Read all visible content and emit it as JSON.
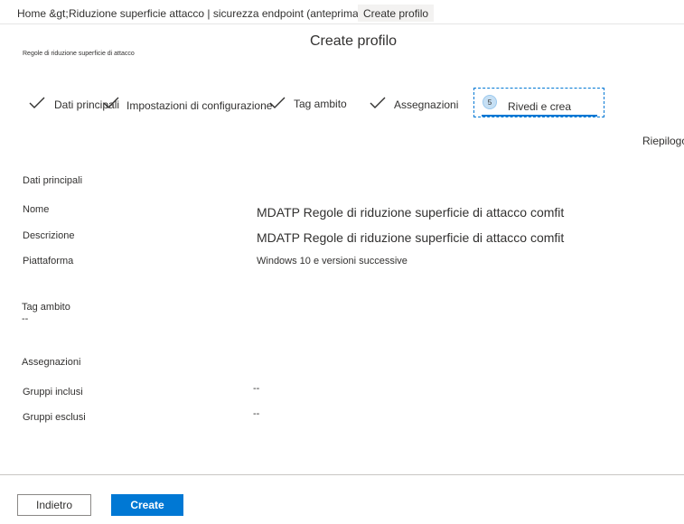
{
  "breadcrumb": {
    "home": "Home &gt;",
    "middle": "Riduzione superficie attacco | sicurezza endpoint (anteprima) &gt;",
    "current": "Create profilo"
  },
  "header": {
    "title": "Create profilo",
    "subtitle": "Regole di riduzione superficie di attacco"
  },
  "steps": [
    {
      "label": "Dati principali",
      "state": "done"
    },
    {
      "label": "Impostazioni di configurazione",
      "state": "done"
    },
    {
      "label": "Tag ambito",
      "state": "done"
    },
    {
      "label": "Assegnazioni",
      "state": "done"
    },
    {
      "number": "5",
      "label": "Rivedi e crea",
      "state": "active"
    }
  ],
  "summary_link": "Riepilogo",
  "basics": {
    "section_title": "Dati principali",
    "name_label": "Nome",
    "name_value": "MDATP Regole di riduzione superficie di attacco comfit",
    "description_label": "Descrizione",
    "description_value": "MDATP Regole di riduzione superficie di attacco comfit",
    "platform_label": "Piattaforma",
    "platform_value": "Windows 10 e versioni successive"
  },
  "scope_tags": {
    "section_title": "Tag ambito",
    "value": "--"
  },
  "assignments": {
    "section_title": "Assegnazioni",
    "included_label": "Gruppi inclusi",
    "included_value": "--",
    "excluded_label": "Gruppi esclusi",
    "excluded_value": "--"
  },
  "footer": {
    "back_label": "Indietro",
    "create_label": "Create"
  },
  "colors": {
    "accent": "#0078d4",
    "text": "#323130",
    "active_step_circle": "#c7e0f4"
  }
}
